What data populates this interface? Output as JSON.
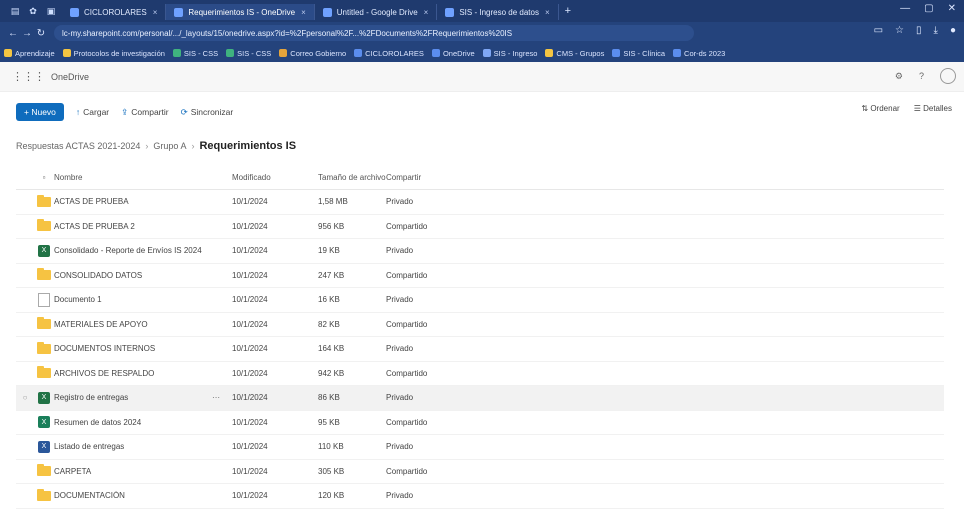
{
  "browser": {
    "tabs": [
      {
        "label": "CICLOROLARES",
        "active": false
      },
      {
        "label": "Requerimientos IS - OneDrive",
        "active": true
      },
      {
        "label": "Untitled - Google Drive",
        "active": false
      },
      {
        "label": "SIS - Ingreso de datos",
        "active": false
      }
    ],
    "new_tab": "+",
    "url": "lc-my.sharepoint.com/personal/.../_layouts/15/onedrive.aspx?id=%2Fpersonal%2F...%2FDocuments%2FRequerimientos%20IS",
    "bookmarks": [
      "Aprendizaje",
      "Protocolos de investigación",
      "SIS - CSS",
      "SIS - CSS",
      "Correo Gobierno",
      "CICLOROLARES",
      "OneDrive",
      "SIS - Ingreso",
      "CMS - Grupos",
      "SIS - Clínica",
      "Cor-ds 2023"
    ]
  },
  "app": {
    "name": "OneDrive",
    "waffle_icon": "waffle-icon"
  },
  "commands": {
    "new": "+ Nuevo",
    "upload": "Cargar",
    "share": "Compartir",
    "sync": "Sincronizar",
    "sort": "Ordenar",
    "view": "Detalles"
  },
  "breadcrumb": {
    "items": [
      "Respuestas ACTAS 2021-2024",
      "Grupo A"
    ],
    "current": "Requerimientos IS"
  },
  "table": {
    "headers": {
      "name": "Nombre",
      "modified": "Modificado",
      "size": "Tamaño de archivo",
      "sharing": "Compartir"
    },
    "rows": [
      {
        "type": "folder",
        "name": "ACTAS DE PRUEBA",
        "modified": "10/1/2024",
        "size": "1,58 MB",
        "sharing": "Privado"
      },
      {
        "type": "folder",
        "name": "ACTAS DE PRUEBA 2",
        "modified": "10/1/2024",
        "size": "956 KB",
        "sharing": "Compartido"
      },
      {
        "type": "excel",
        "name": "Consolidado - Reporte de Envíos IS 2024",
        "modified": "10/1/2024",
        "size": "19 KB",
        "sharing": "Privado"
      },
      {
        "type": "folder",
        "name": "CONSOLIDADO DATOS",
        "modified": "10/1/2024",
        "size": "247 KB",
        "sharing": "Compartido"
      },
      {
        "type": "blank",
        "name": "Documento 1",
        "modified": "10/1/2024",
        "size": "16 KB",
        "sharing": "Privado"
      },
      {
        "type": "folder",
        "name": "MATERIALES DE APOYO",
        "modified": "10/1/2024",
        "size": "82 KB",
        "sharing": "Compartido"
      },
      {
        "type": "folder",
        "name": "DOCUMENTOS INTERNOS",
        "modified": "10/1/2024",
        "size": "164 KB",
        "sharing": "Privado"
      },
      {
        "type": "folder",
        "name": "ARCHIVOS DE RESPALDO",
        "modified": "10/1/2024",
        "size": "942 KB",
        "sharing": "Compartido"
      },
      {
        "type": "excel",
        "name": "Registro de entregas",
        "modified": "10/1/2024",
        "size": "86 KB",
        "sharing": "Privado",
        "selected": true
      },
      {
        "type": "excel-teal",
        "name": "Resumen de datos 2024",
        "modified": "10/1/2024",
        "size": "95 KB",
        "sharing": "Compartido"
      },
      {
        "type": "excel-blue",
        "name": "Listado de entregas",
        "modified": "10/1/2024",
        "size": "110 KB",
        "sharing": "Privado"
      },
      {
        "type": "folder",
        "name": "CARPETA",
        "modified": "10/1/2024",
        "size": "305 KB",
        "sharing": "Compartido"
      },
      {
        "type": "folder",
        "name": "DOCUMENTACIÓN",
        "modified": "10/1/2024",
        "size": "120 KB",
        "sharing": "Privado"
      }
    ]
  }
}
